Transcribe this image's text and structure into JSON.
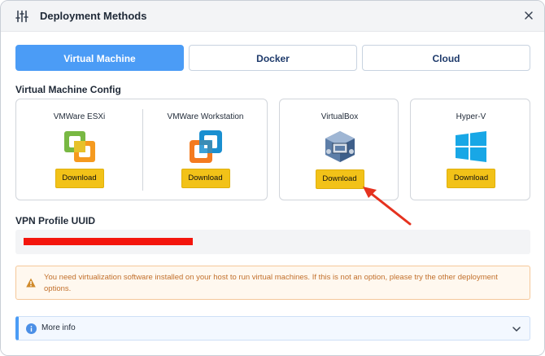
{
  "window": {
    "title": "Deployment Methods"
  },
  "tabs": [
    {
      "label": "Virtual Machine",
      "active": true
    },
    {
      "label": "Docker",
      "active": false
    },
    {
      "label": "Cloud",
      "active": false
    }
  ],
  "vm_config": {
    "heading": "Virtual Machine Config",
    "options": [
      {
        "name": "VMWare ESXi",
        "icon": "vmware-esxi-icon",
        "button": "Download"
      },
      {
        "name": "VMWare Workstation",
        "icon": "vmware-workstation-icon",
        "button": "Download"
      },
      {
        "name": "VirtualBox",
        "icon": "virtualbox-icon",
        "button": "Download"
      },
      {
        "name": "Hyper-V",
        "icon": "windows-icon",
        "button": "Download"
      }
    ]
  },
  "vpn": {
    "label": "VPN Profile UUID",
    "value_redacted": true
  },
  "warning": {
    "icon": "warning-triangle-icon",
    "text": "You need virtualization software installed on your host to run virtual machines. If this is not an option, please try the other deployment options."
  },
  "more_info": {
    "label": "More info",
    "icon": "info-icon"
  },
  "colors": {
    "accent": "#4b9cf6",
    "download": "#f2c218",
    "warning_text": "#c2702c",
    "annotation_arrow": "#e5321f"
  }
}
